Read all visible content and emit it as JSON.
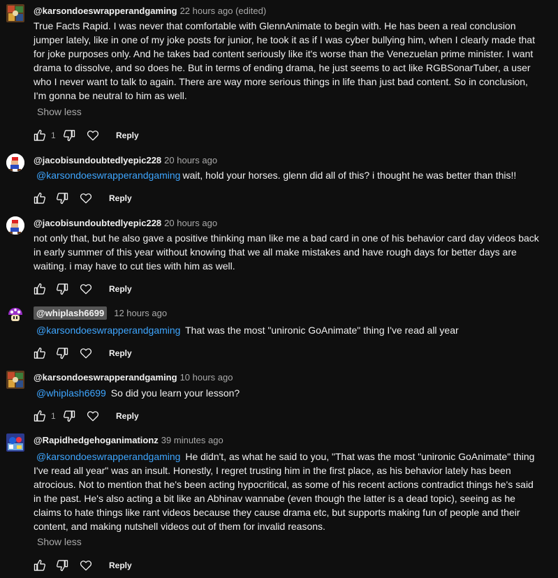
{
  "comments": [
    {
      "author": "@karsondoeswrapperandgaming",
      "time": "22 hours ago (edited)",
      "mention": "",
      "text": "True Facts Rapid. I was never that comfortable with GlennAnimate to begin with. He has been a real conclusion jumper lately, like in one of my joke posts for junior, he took it as if I was cyber bullying him, when I clearly made that for joke purposes only. And he takes bad content seriously like it's worse than the Venezuelan prime minister. I want drama to dissolve, and so does he. But in terms of ending drama, he just seems to act like RGBSonarTuber, a user who I never want to talk to again. There are way more serious things in life than just bad content. So in conclusion, I'm gonna be neutral to him as well.",
      "show_less": "Show less",
      "likes": "1",
      "reply": "Reply"
    },
    {
      "author": "@jacobisundoubtedlyepic228",
      "time": "20 hours ago",
      "mention": "@karsondoeswrapperandgaming",
      "text": "wait, hold your horses. glenn did all of this? i thought he was better than this!!",
      "likes": "",
      "reply": "Reply"
    },
    {
      "author": "@jacobisundoubtedlyepic228",
      "time": "20 hours ago",
      "mention": "",
      "text": "not only that, but he also gave a positive thinking man like me a bad card in one of his behavior card day videos back in early summer of this year without knowing that we all make mistakes and have rough days for better days are waiting. i may have to cut ties with him as well.",
      "likes": "",
      "reply": "Reply"
    },
    {
      "author": "@whiplash6699",
      "time": "12 hours ago",
      "mention": "@karsondoeswrapperandgaming",
      "text": "That was the most \"unironic GoAnimate\" thing I've read all year",
      "likes": "",
      "reply": "Reply"
    },
    {
      "author": "@karsondoeswrapperandgaming",
      "time": "10 hours ago",
      "mention": "@whiplash6699",
      "text": "So did you learn your lesson?",
      "likes": "1",
      "reply": "Reply"
    },
    {
      "author": "@Rapidhedgehoganimationz",
      "time": "39 minutes ago",
      "mention": "@karsondoeswrapperandgaming",
      "text": "He didn't, as what he said to you, \"That was the most \"unironic GoAnimate\" thing I've read all year\" was an insult. Honestly, I regret trusting him in the first place, as his behavior lately has been atrocious. Not to mention that he's been acting hypocritical, as some of his recent actions contradict things he's said in the past. He's also acting a bit like an Abhinav wannabe (even though the latter is a dead topic), seeing as he claims to hate things like rant videos because they cause drama etc, but supports making fun of people and their content, and making nutshell videos out of them for invalid reasons.",
      "show_less": "Show less",
      "likes": "",
      "reply": "Reply"
    }
  ],
  "colors": {
    "background": "#0f0f0f",
    "mention": "#3ea6ff",
    "secondary_text": "#aaaaaa"
  },
  "icons": {
    "like": "thumb-up-icon",
    "dislike": "thumb-down-icon",
    "heart": "heart-icon"
  }
}
